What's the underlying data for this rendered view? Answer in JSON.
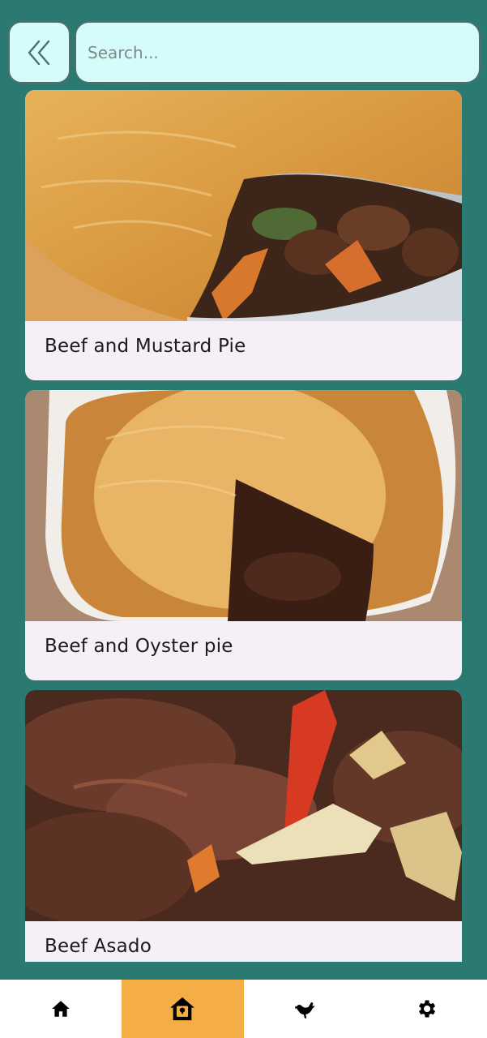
{
  "search": {
    "placeholder": "Search..."
  },
  "recipes": [
    {
      "title": "Beef and Mustard Pie"
    },
    {
      "title": "Beef and Oyster pie"
    },
    {
      "title": "Beef Asado"
    }
  ],
  "nav": {
    "items": [
      {
        "icon": "home-icon"
      },
      {
        "icon": "recipe-house-icon",
        "active": true
      },
      {
        "icon": "chicken-icon"
      },
      {
        "icon": "gear-icon"
      }
    ],
    "active_color": "#f5ae46"
  },
  "colors": {
    "background": "#2a7a72",
    "search_bg": "#d6fbfb",
    "card_bg": "#f6eff7"
  }
}
